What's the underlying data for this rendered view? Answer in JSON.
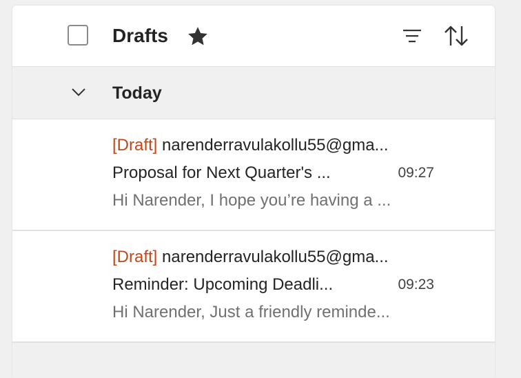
{
  "header": {
    "title": "Drafts"
  },
  "group": {
    "label": "Today"
  },
  "messages": [
    {
      "tag": "[Draft]",
      "recipient": "narenderravulakollu55@gma...",
      "subject": "Proposal for Next Quarter's ...",
      "time": "09:27",
      "preview": "Hi Narender, I hope you’re having a ..."
    },
    {
      "tag": "[Draft]",
      "recipient": "narenderravulakollu55@gma...",
      "subject": "Reminder: Upcoming Deadli...",
      "time": "09:23",
      "preview": "Hi Narender, Just a friendly reminde..."
    }
  ],
  "icons": {
    "select_all": "checkbox-icon",
    "favorite": "star-icon",
    "filter": "filter-icon",
    "sort": "sort-icon",
    "collapse": "chevron-down-icon"
  },
  "colors": {
    "draft_tag": "#c4471a",
    "background": "#f0f0f0",
    "panel": "#ffffff"
  }
}
